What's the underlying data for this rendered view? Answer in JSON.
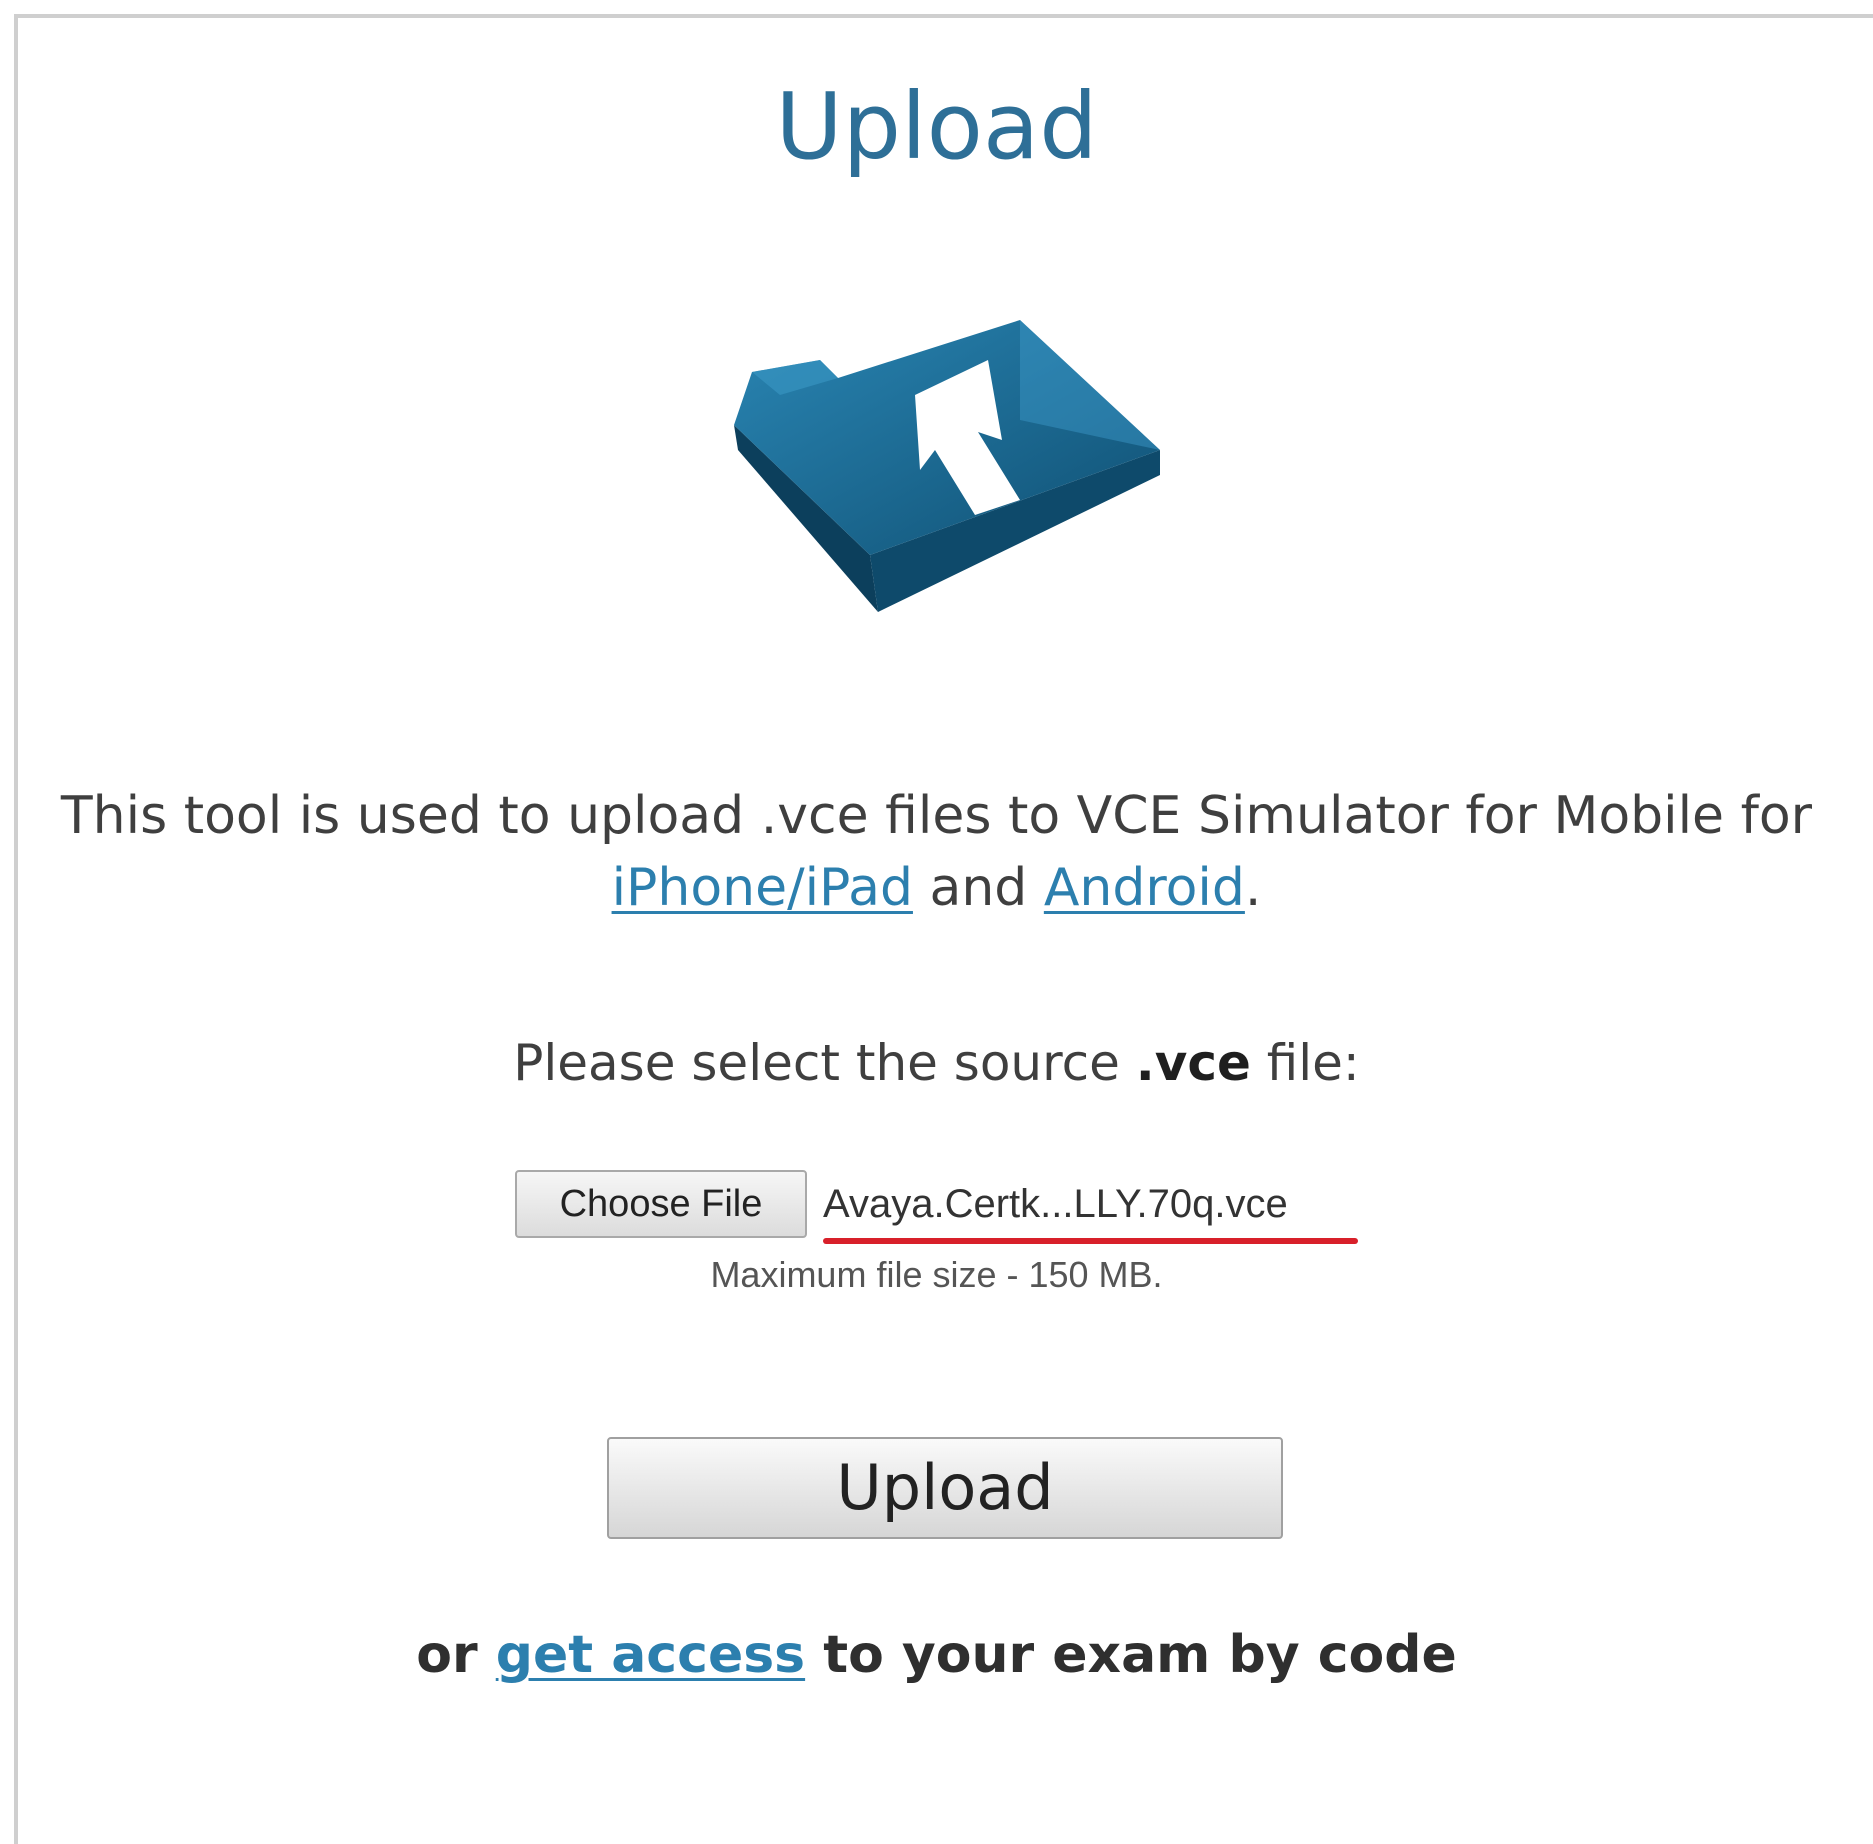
{
  "page": {
    "title": "Upload"
  },
  "icon": {
    "name": "folder-upload-icon",
    "color": "#1f6d95"
  },
  "description": {
    "text_before": "This tool is used to upload .vce files to VCE Simulator for Mobile for",
    "link_iphone": "iPhone/iPad",
    "text_middle": " and ",
    "link_android": "Android",
    "text_after": "."
  },
  "file_select": {
    "label_before": "Please select the source ",
    "label_bold": ".vce",
    "label_after": " file:",
    "choose_button": "Choose File",
    "selected_file": "Avaya.Certk...LLY.70q.vce",
    "max_size_note": "Maximum file size - 150 MB."
  },
  "upload_button": "Upload",
  "access": {
    "prefix": "or ",
    "link": "get access",
    "suffix": " to your exam by code"
  },
  "colors": {
    "title": "#2e6f97",
    "link": "#2c7fae",
    "underline_mark": "#d8202a"
  }
}
